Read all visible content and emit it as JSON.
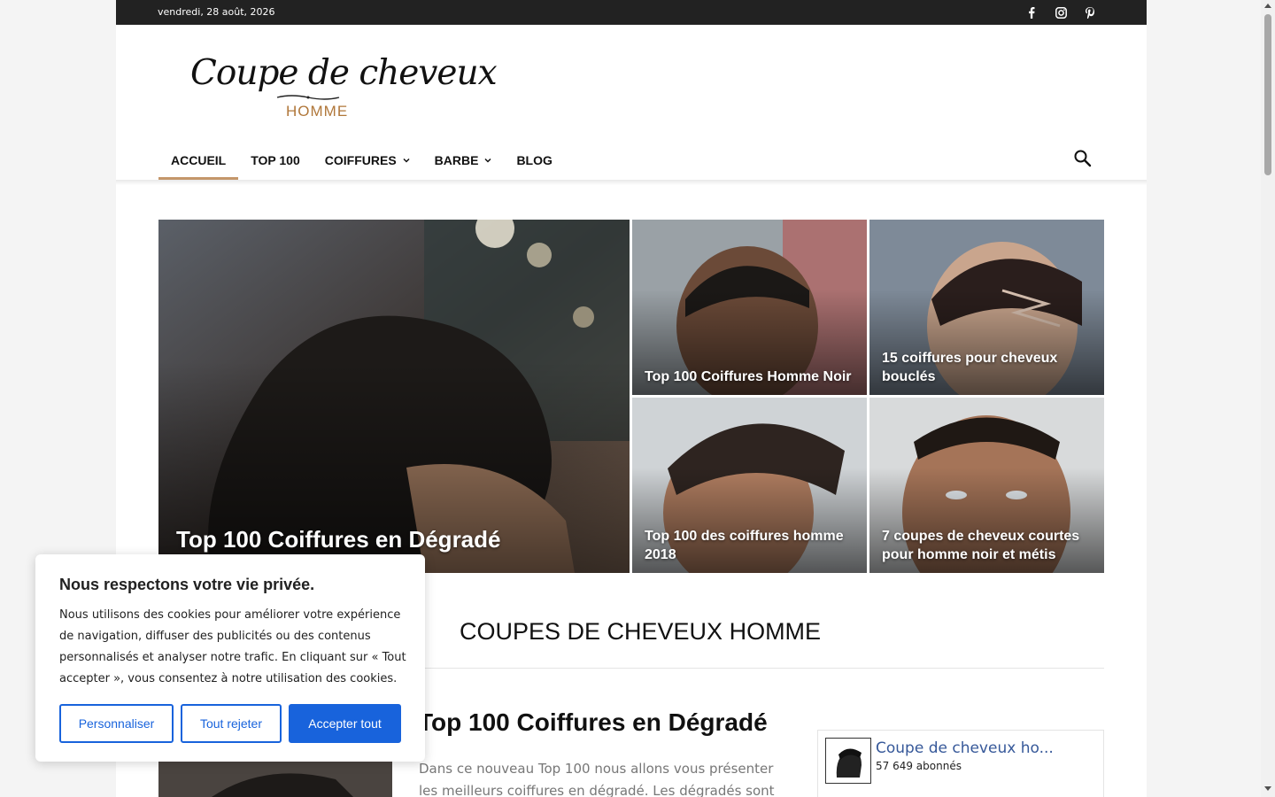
{
  "topbar": {
    "date": "vendredi, 28 août, 2026",
    "social": [
      "facebook-icon",
      "instagram-icon",
      "pinterest-icon"
    ]
  },
  "logo": {
    "script": "Coupe de cheveux",
    "sub": "HOMME"
  },
  "nav": {
    "items": [
      {
        "label": "ACCUEIL",
        "active": true,
        "dropdown": false
      },
      {
        "label": "TOP 100",
        "active": false,
        "dropdown": false
      },
      {
        "label": "COIFFURES",
        "active": false,
        "dropdown": true
      },
      {
        "label": "BARBE",
        "active": false,
        "dropdown": true
      },
      {
        "label": "BLOG",
        "active": false,
        "dropdown": false
      }
    ],
    "accent": "#c4966a"
  },
  "featured": [
    {
      "title": "Top 100 Coiffures en Dégradé"
    },
    {
      "title": "Top 100 Coiffures Homme Noir"
    },
    {
      "title": "15 coiffures pour cheveux bouclés"
    },
    {
      "title": "Top 100 des coiffures homme 2018"
    },
    {
      "title": "7 coupes de cheveux courtes pour homme noir et métis"
    }
  ],
  "section": {
    "title": "COUPES DE CHEVEUX HOMME"
  },
  "article": {
    "title": "Top 100 Coiffures en Dégradé",
    "excerpt": "Dans ce nouveau Top 100 nous allons vous présenter les meilleurs coiffures en dégradé. Les dégradés sont"
  },
  "facebook": {
    "name": "Coupe de cheveux ho...",
    "followers": "57 649 abonnés"
  },
  "cookie": {
    "title": "Nous respectons votre vie privée.",
    "body": "Nous utilisons des cookies pour améliorer votre expérience de navigation, diffuser des publicités ou des contenus personnalisés et analyser notre trafic. En cliquant sur « Tout accepter », vous consentez à notre utilisation des cookies.",
    "customize": "Personnaliser",
    "reject": "Tout rejeter",
    "accept": "Accepter tout",
    "accent": "#1863dc"
  }
}
